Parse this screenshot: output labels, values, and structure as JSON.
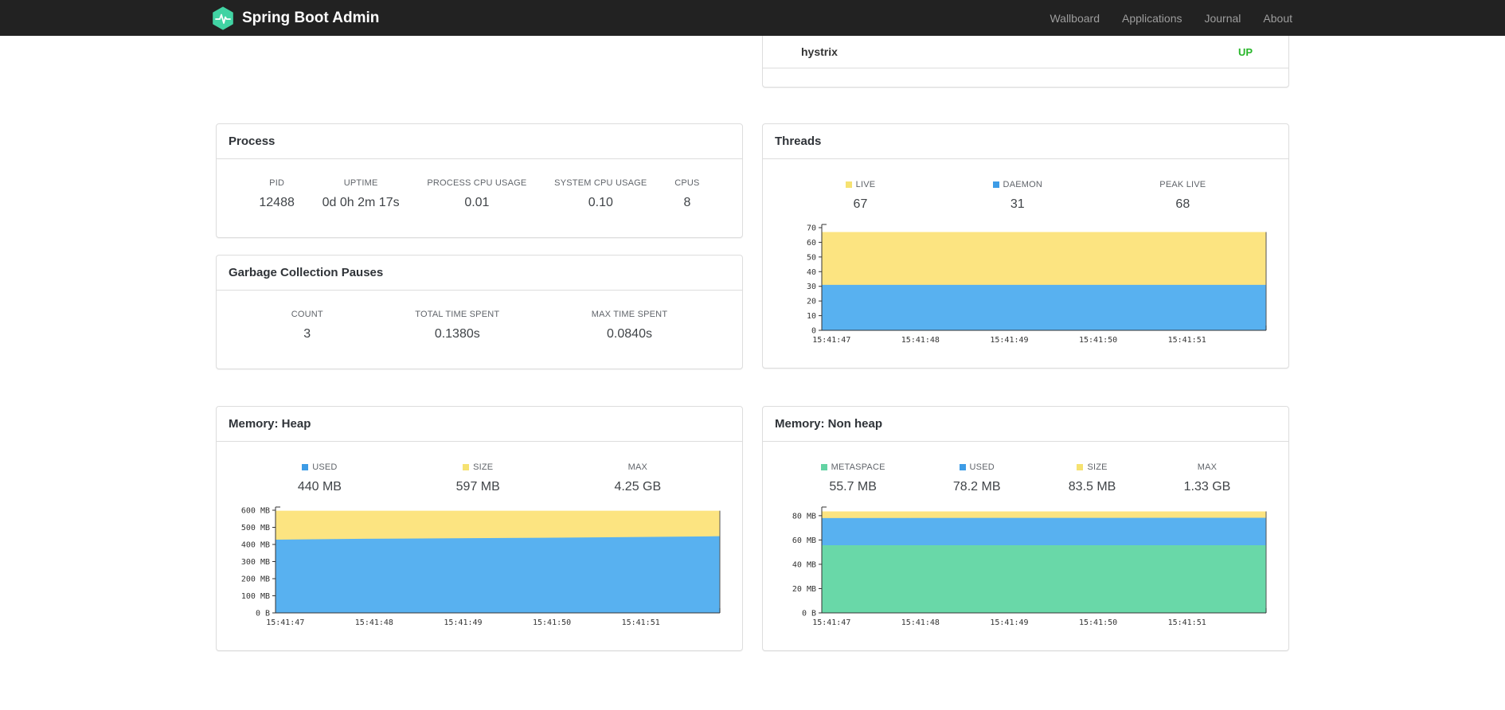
{
  "navbar": {
    "brand": "Spring Boot Admin",
    "links": [
      {
        "label": "Wallboard"
      },
      {
        "label": "Applications"
      },
      {
        "label": "Journal"
      },
      {
        "label": "About"
      }
    ]
  },
  "application_row": {
    "name": "hystrix",
    "status": "UP",
    "status_color": "#28b62a"
  },
  "logo_color": "#41d3a3",
  "process": {
    "title": "Process",
    "metrics": [
      {
        "label": "PID",
        "value": "12488"
      },
      {
        "label": "UPTIME",
        "value": "0d 0h 2m 17s"
      },
      {
        "label": "PROCESS CPU USAGE",
        "value": "0.01"
      },
      {
        "label": "SYSTEM CPU USAGE",
        "value": "0.10"
      },
      {
        "label": "CPUS",
        "value": "8"
      }
    ]
  },
  "gc": {
    "title": "Garbage Collection Pauses",
    "metrics": [
      {
        "label": "COUNT",
        "value": "3"
      },
      {
        "label": "TOTAL TIME SPENT",
        "value": "0.1380s"
      },
      {
        "label": "MAX TIME SPENT",
        "value": "0.0840s"
      }
    ]
  },
  "threads": {
    "title": "Threads",
    "legend": [
      {
        "label": "LIVE",
        "value": "67",
        "color": "#f6e271"
      },
      {
        "label": "DAEMON",
        "value": "31",
        "color": "#3d9ce6"
      },
      {
        "label": "PEAK LIVE",
        "value": "68",
        "color": ""
      }
    ]
  },
  "heap": {
    "title": "Memory: Heap",
    "legend": [
      {
        "label": "USED",
        "value": "440 MB",
        "color": "#3d9ce6"
      },
      {
        "label": "SIZE",
        "value": "597 MB",
        "color": "#f6e271"
      },
      {
        "label": "MAX",
        "value": "4.25 GB",
        "color": ""
      }
    ]
  },
  "nonheap": {
    "title": "Memory: Non heap",
    "legend": [
      {
        "label": "METASPACE",
        "value": "55.7 MB",
        "color": "#63d3a3"
      },
      {
        "label": "USED",
        "value": "78.2 MB",
        "color": "#3d9ce6"
      },
      {
        "label": "SIZE",
        "value": "83.5 MB",
        "color": "#f6e271"
      },
      {
        "label": "MAX",
        "value": "1.33 GB",
        "color": ""
      }
    ]
  },
  "chart_data": [
    {
      "id": "threads-chart",
      "type": "area",
      "ymax": 70,
      "yticks": [
        {
          "v": 0,
          "label": "0"
        },
        {
          "v": 10,
          "label": "10"
        },
        {
          "v": 20,
          "label": "20"
        },
        {
          "v": 30,
          "label": "30"
        },
        {
          "v": 40,
          "label": "40"
        },
        {
          "v": 50,
          "label": "50"
        },
        {
          "v": 60,
          "label": "60"
        },
        {
          "v": 70,
          "label": "70"
        }
      ],
      "xlabels": [
        "15:41:47",
        "15:41:48",
        "15:41:49",
        "15:41:50",
        "15:41:51"
      ],
      "series": [
        {
          "name": "LIVE",
          "color": "#fce481",
          "values": [
            67,
            67,
            67,
            67,
            67,
            67
          ]
        },
        {
          "name": "DAEMON",
          "color": "#58b1f0",
          "values": [
            31,
            31,
            31,
            31,
            31,
            31
          ]
        }
      ]
    },
    {
      "id": "heap-chart",
      "type": "area",
      "ymax": 600,
      "yticks": [
        {
          "v": 0,
          "label": "0 B"
        },
        {
          "v": 100,
          "label": "100 MB"
        },
        {
          "v": 200,
          "label": "200 MB"
        },
        {
          "v": 300,
          "label": "300 MB"
        },
        {
          "v": 400,
          "label": "400 MB"
        },
        {
          "v": 500,
          "label": "500 MB"
        },
        {
          "v": 600,
          "label": "600 MB"
        }
      ],
      "xlabels": [
        "15:41:47",
        "15:41:48",
        "15:41:49",
        "15:41:50",
        "15:41:51"
      ],
      "series": [
        {
          "name": "SIZE",
          "color": "#fce481",
          "values": [
            597,
            597,
            597,
            597,
            597,
            597
          ]
        },
        {
          "name": "USED",
          "color": "#58b1f0",
          "values": [
            428,
            433,
            436,
            439,
            443,
            448
          ]
        }
      ]
    },
    {
      "id": "nonheap-chart",
      "type": "area",
      "ymax": 84.5,
      "yticks": [
        {
          "v": 0,
          "label": "0 B"
        },
        {
          "v": 20,
          "label": "20 MB"
        },
        {
          "v": 40,
          "label": "40 MB"
        },
        {
          "v": 60,
          "label": "60 MB"
        },
        {
          "v": 80,
          "label": "80 MB"
        }
      ],
      "xlabels": [
        "15:41:47",
        "15:41:48",
        "15:41:49",
        "15:41:50",
        "15:41:51"
      ],
      "series": [
        {
          "name": "SIZE",
          "color": "#fce481",
          "values": [
            83.5,
            83.5,
            83.5,
            83.5,
            83.5,
            83.5
          ]
        },
        {
          "name": "USED",
          "color": "#58b1f0",
          "values": [
            78,
            78.1,
            78.2,
            78.2,
            78.3,
            78.3
          ]
        },
        {
          "name": "METASPACE",
          "color": "#69d8a8",
          "values": [
            55.7,
            55.7,
            55.7,
            55.7,
            55.7,
            55.7
          ]
        }
      ]
    }
  ]
}
